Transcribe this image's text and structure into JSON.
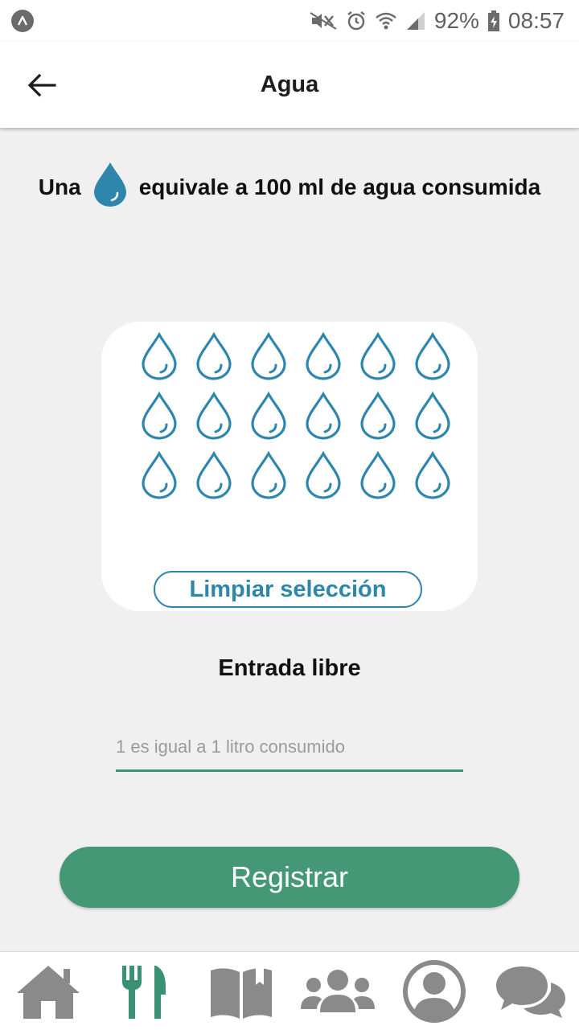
{
  "status_bar": {
    "battery": "92%",
    "time": "08:57",
    "icons": [
      "app-notification-icon",
      "mute-icon",
      "alarm-icon",
      "wifi-icon",
      "signal-icon",
      "battery-charging-icon"
    ]
  },
  "app_bar": {
    "title": "Agua",
    "back_icon": "arrow-left-icon"
  },
  "info": {
    "prefix": "Una",
    "suffix": "equivale a 100 ml de agua consumida",
    "icon": "water-drop-icon"
  },
  "drops": {
    "count": 18,
    "selected": 0,
    "icon": "water-drop-outline-icon"
  },
  "clear_button": "Limpiar selección",
  "free_entry": {
    "title": "Entrada libre",
    "placeholder": "1 es igual a 1 litro consumido",
    "value": ""
  },
  "register_button": "Registrar",
  "bottom_nav": {
    "items": [
      {
        "icon": "home-icon",
        "active": false
      },
      {
        "icon": "utensils-icon",
        "active": true
      },
      {
        "icon": "book-icon",
        "active": false
      },
      {
        "icon": "users-icon",
        "active": false
      },
      {
        "icon": "user-circle-icon",
        "active": false
      },
      {
        "icon": "chat-icon",
        "active": false
      }
    ]
  },
  "colors": {
    "accent": "#449876",
    "drop": "#2f86ad",
    "nav_inactive": "#8a8a8a",
    "nav_active": "#3a9173",
    "background": "#f0f0f0"
  }
}
